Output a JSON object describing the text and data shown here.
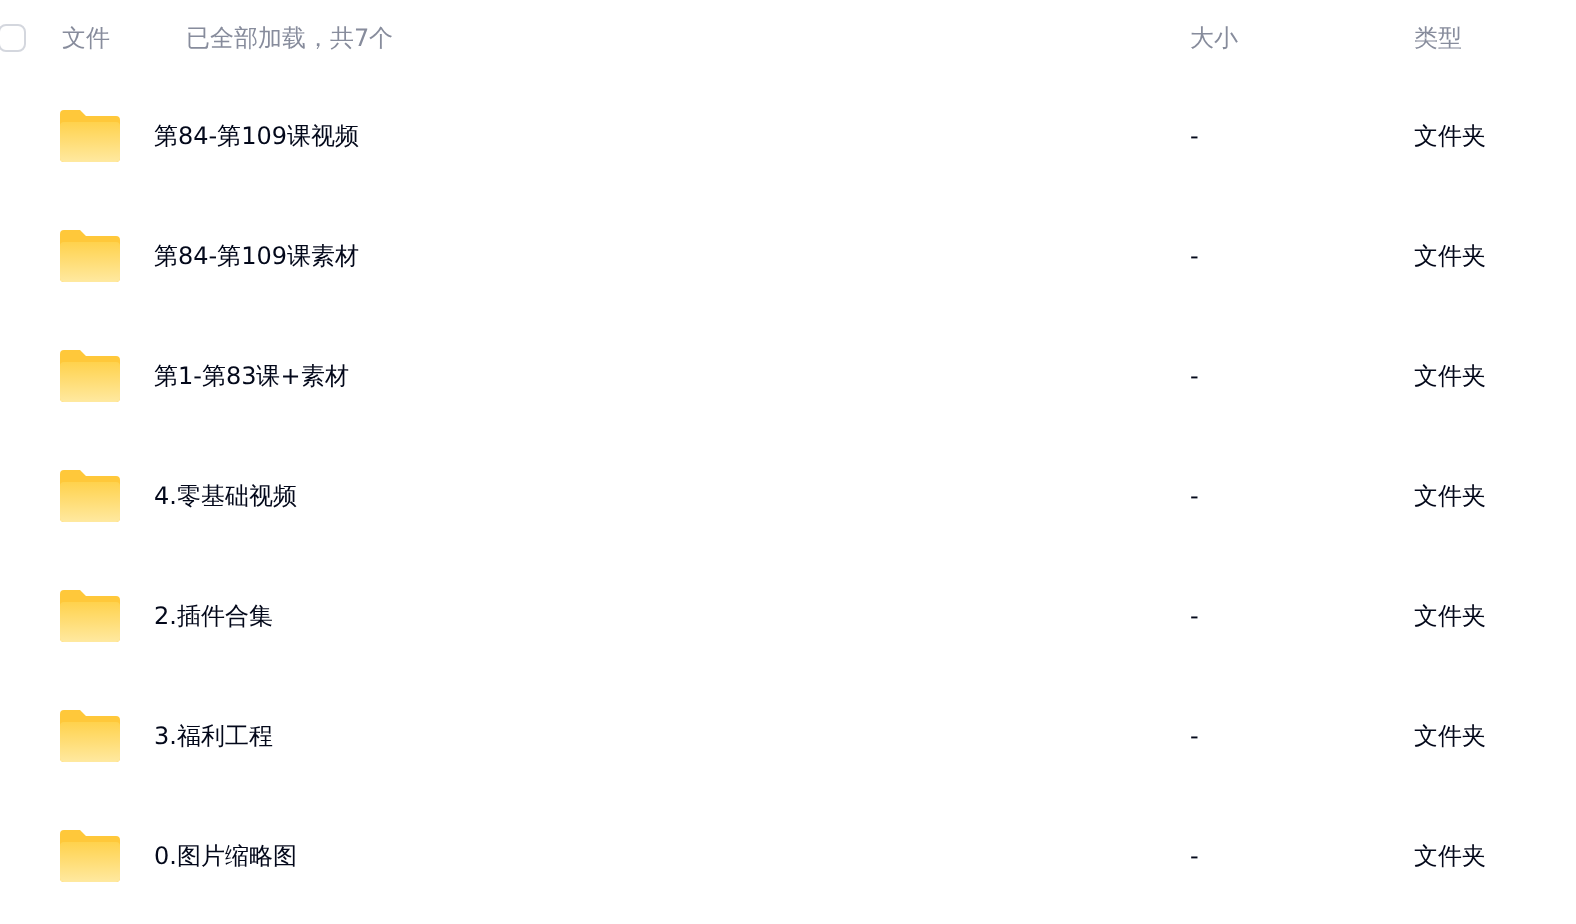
{
  "header": {
    "select_all": {
      "checked": false
    },
    "name_label": "文件",
    "load_status": "已全部加载，共7个",
    "size_label": "大小",
    "type_label": "类型"
  },
  "rows": [
    {
      "name": "第84-第109课视频",
      "size": "-",
      "type": "文件夹"
    },
    {
      "name": "第84-第109课素材",
      "size": "-",
      "type": "文件夹"
    },
    {
      "name": "第1-第83课+素材",
      "size": "-",
      "type": "文件夹"
    },
    {
      "name": "4.零基础视频",
      "size": "-",
      "type": "文件夹"
    },
    {
      "name": "2.插件合集",
      "size": "-",
      "type": "文件夹"
    },
    {
      "name": "3.福利工程",
      "size": "-",
      "type": "文件夹"
    },
    {
      "name": "0.图片缩略图",
      "size": "-",
      "type": "文件夹"
    }
  ]
}
